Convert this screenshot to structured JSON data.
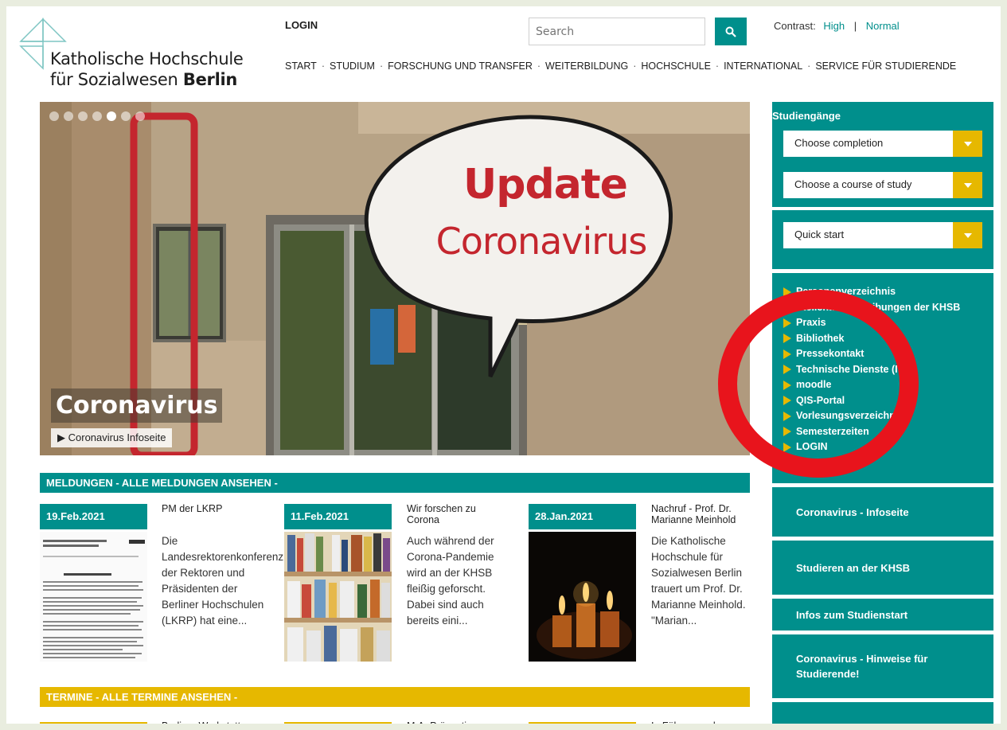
{
  "header": {
    "logo_line1": "Katholische Hochschule",
    "logo_line2_prefix": "für Sozialwesen ",
    "logo_line2_bold": "Berlin",
    "login": "LOGIN",
    "search_placeholder": "Search",
    "contrast_label": "Contrast:",
    "contrast_high": "High",
    "contrast_sep": "|",
    "contrast_normal": "Normal"
  },
  "nav": {
    "items": [
      "START",
      "STUDIUM",
      "FORSCHUNG UND TRANSFER",
      "WEITERBILDUNG",
      "HOCHSCHULE",
      "INTERNATIONAL",
      "SERVICE FÜR STUDIERENDE"
    ],
    "separator": "·"
  },
  "hero": {
    "title_bold": "Update",
    "title_regular": "Coronavirus",
    "caption": "Coronavirus",
    "link_prefix": "▶",
    "link": "Coronavirus Infoseite",
    "slides": 7,
    "active_slide": 5
  },
  "news": {
    "heading": "MELDUNGEN - ALLE MELDUNGEN ANSEHEN -",
    "items": [
      {
        "date": "19.Feb.2021",
        "title": "PM der LKRP",
        "text": "Die Landesrektorenkonferenz der Rektoren und Präsidenten der Berliner Hochschulen (LKRP) hat eine..."
      },
      {
        "date": "11.Feb.2021",
        "title": "Wir forschen zu Corona",
        "text": "Auch während der Corona-Pandemie wird an der KHSB fleißig geforscht. Dabei sind auch bereits eini..."
      },
      {
        "date": "28.Jan.2021",
        "title": "Nachruf - Prof. Dr. Marianne Meinhold",
        "text": "Die Katholische Hochschule für Sozialwesen Berlin trauert um Prof. Dr. Marianne Meinhold. \"Marian..."
      }
    ]
  },
  "events": {
    "heading": "TERMINE - ALLE TERMINE ANSEHEN -",
    "items": [
      {
        "title": "Berliner Werkstatt"
      },
      {
        "title": "M.A. Präventive"
      },
      {
        "title": "In Führung gehen:"
      }
    ]
  },
  "sidebar": {
    "studies_heading": "Studiengänge",
    "select_completion": "Choose completion",
    "select_course": "Choose a course of study",
    "select_quickstart": "Quick start",
    "links": [
      "Personenverzeichnis",
      "Stellenausschreibungen der KHSB",
      "Praxis",
      "Bibliothek",
      "Pressekontakt",
      "Technische Dienste (IT)",
      "moodle",
      "QIS-Portal",
      "Vorlesungsverzeichnis",
      "Semesterzeiten",
      "LOGIN"
    ],
    "boxes": [
      "Coronavirus - Infoseite",
      "Studieren an der KHSB",
      "Infos zum Studienstart",
      "Coronavirus - Hinweise für Studierende!"
    ]
  },
  "colors": {
    "teal": "#008f8c",
    "yellow": "#e6b800",
    "red_annotation": "#e8141c",
    "update_red": "#c4262e"
  }
}
